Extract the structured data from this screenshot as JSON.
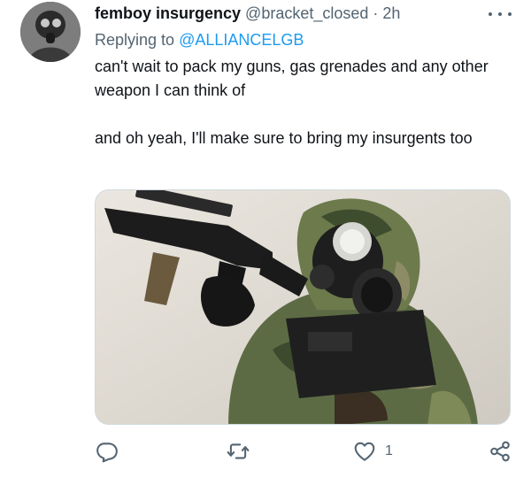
{
  "tweet": {
    "display_name": "femboy insurgency",
    "handle": "@bracket_closed",
    "separator": "·",
    "time": "2h",
    "replying_prefix": "Replying to",
    "replying_handle": "@ALLIANCELGB",
    "text_line1": "can't wait to pack my guns, gas grenades and any other weapon I can think of",
    "text_line2": "and oh yeah, I'll make sure to bring my insurgents too",
    "like_count": "1"
  },
  "icons": {
    "more": "more-horizontal-icon",
    "reply": "reply-icon",
    "retweet": "retweet-icon",
    "like": "heart-icon",
    "share": "share-icon"
  },
  "colors": {
    "text": "#0f1419",
    "secondary": "#536471",
    "link": "#1d9bf0"
  }
}
